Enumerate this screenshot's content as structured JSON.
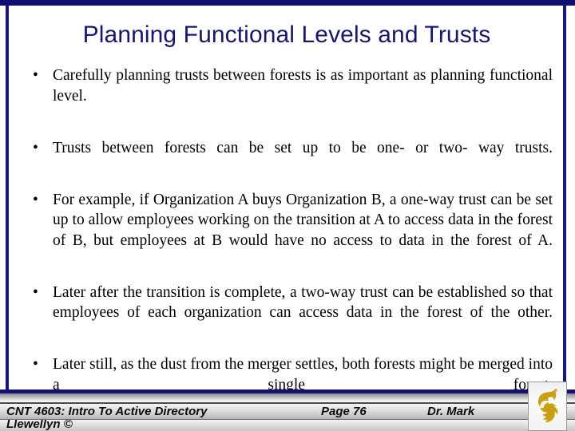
{
  "slide": {
    "title": "Planning Functional Levels and Trusts",
    "title_color": "#17176f",
    "background_color": "#ffffff",
    "accent_color": "#11116f",
    "bullet_marker": "•",
    "bullets": [
      "Carefully planning trusts between forests is as important as planning functional level.",
      "Trusts between forests can be set up to be one- or two- way trusts.",
      "For example, if Organization A buys Organization B, a one-way trust can be set up to allow employees working on the transition at A to access data in the forest of B, but employees at B would have no access to data in the forest of A.",
      "Later after the transition is complete, a two-way trust can be established so that employees of each organization can access data in the forest of the other.",
      "Later still, as the dust from the merger settles, both forests might be merged into a single forest."
    ]
  },
  "footer": {
    "course": "CNT 4603: Intro To Active Directory",
    "page": "Page 76",
    "author": "Dr. Mark",
    "author_second_line": "Llewellyn ©",
    "logo_name": "ucf-pegasus-logo",
    "logo_color": "#c8a014"
  }
}
